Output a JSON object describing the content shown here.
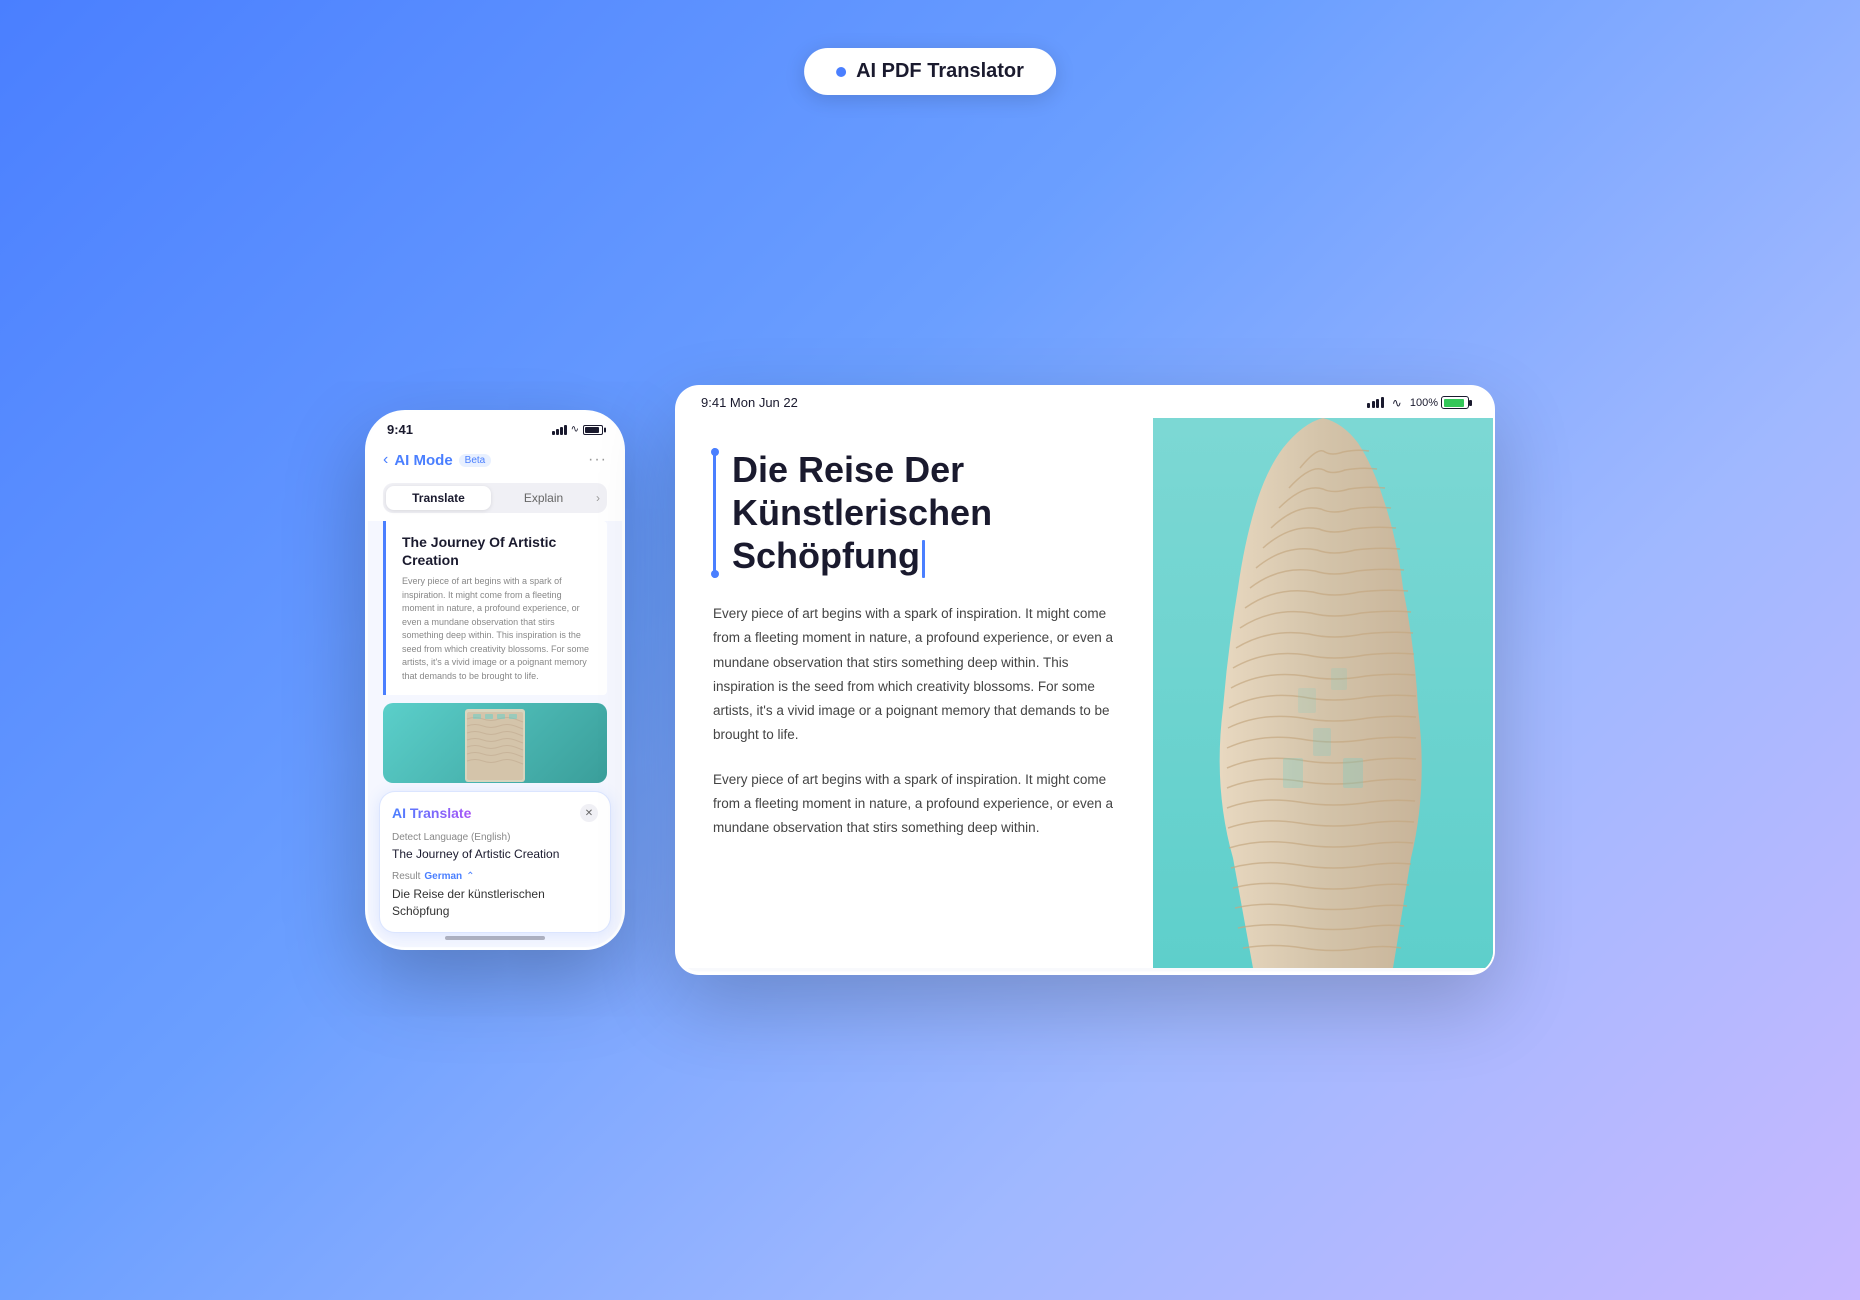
{
  "badge": {
    "dot_color": "#4a7fff",
    "label": "AI PDF Translator"
  },
  "phone": {
    "time": "9:41",
    "nav_title": "AI Mode",
    "nav_beta": "Beta",
    "tab_translate": "Translate",
    "tab_explain": "Explain",
    "doc_title": "The Journey Of Artistic Creation",
    "doc_body": "Every piece of art begins with a spark of inspiration. It might come from a fleeting moment in nature, a profound experience, or even a mundane observation that stirs something deep within. This inspiration is the seed from which creativity blossoms. For some artists, it's a vivid image or a poignant memory that demands to be brought to life.",
    "panel_title": "AI Translate",
    "detect_lang_label": "Detect Language (English)",
    "source_text": "The Journey of Artistic Creation",
    "result_label": "Result",
    "result_lang": "German",
    "result_text": "Die Reise der künstlerischen Schöpfung"
  },
  "tablet": {
    "time_date": "9:41  Mon Jun 22",
    "battery_pct": "100%",
    "main_title_line1": "Die Reise Der",
    "main_title_line2": "Künstlerischen",
    "main_title_line3": "Schöpfung",
    "body1": "Every piece of art begins with a spark of inspiration. It might come from a fleeting moment in nature, a profound experience, or even a mundane observation that stirs something deep within. This inspiration is the seed from which creativity blossoms. For some artists, it's a vivid image or a poignant memory that demands to be brought to life.",
    "body2": "Every piece of art begins with a spark of inspiration. It might come from a fleeting moment in nature, a profound experience, or even a mundane observation that stirs something deep within."
  }
}
